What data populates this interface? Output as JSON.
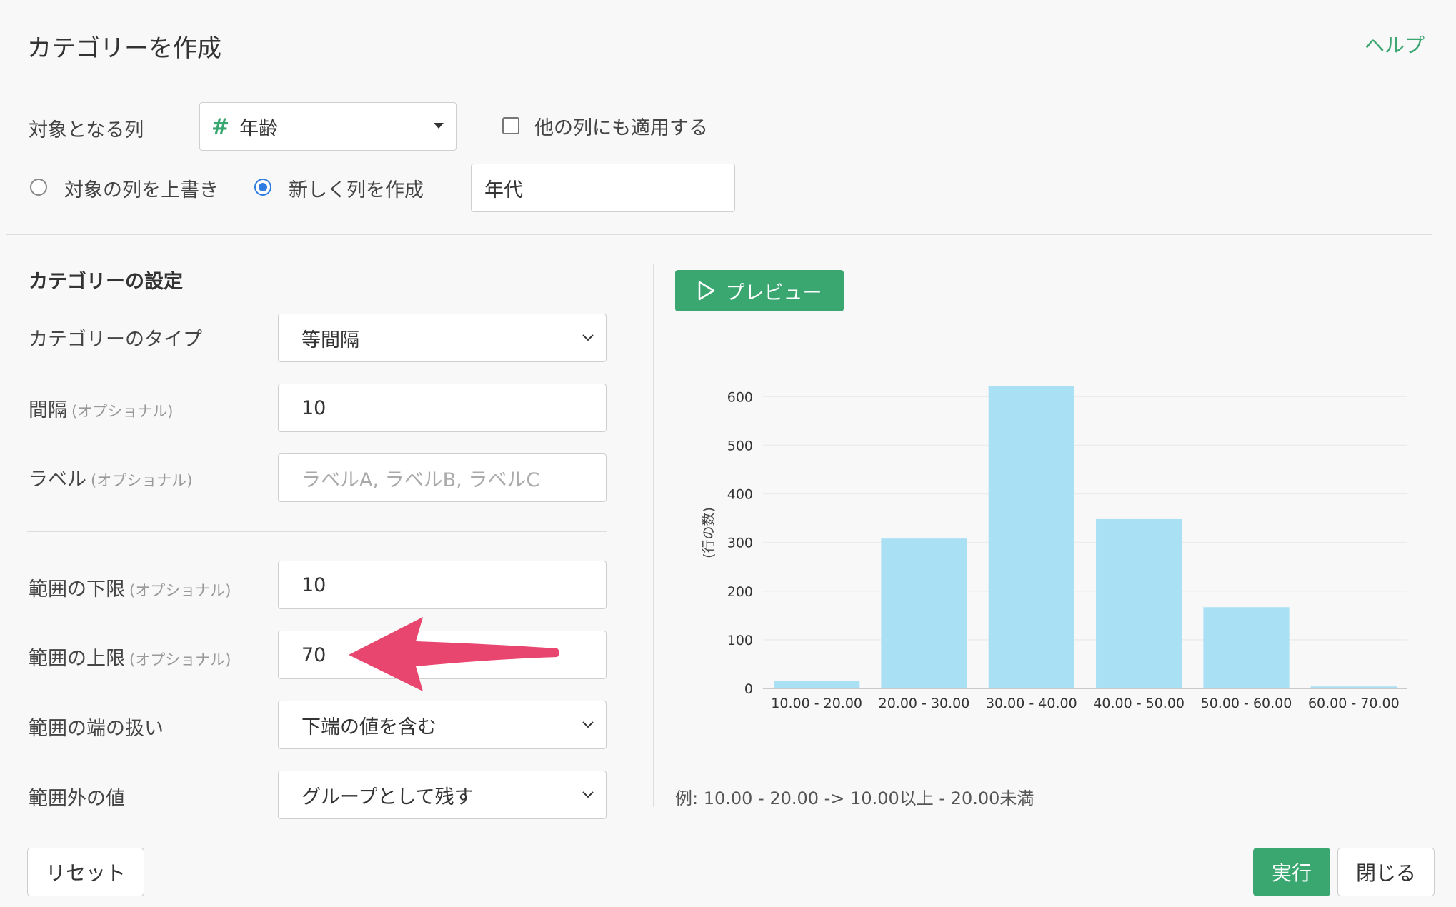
{
  "dialog": {
    "title": "カテゴリーを作成",
    "help": "ヘルプ"
  },
  "target": {
    "label": "対象となる列",
    "column_icon": "#",
    "column_value": "年齢",
    "apply_others_label": "他の列にも適用する"
  },
  "output": {
    "overwrite_label": "対象の列を上書き",
    "new_column_label": "新しく列を作成",
    "new_column_value": "年代"
  },
  "settings": {
    "section_title": "カテゴリーの設定",
    "optional": "(オプショナル)",
    "type_label": "カテゴリーのタイプ",
    "type_value": "等間隔",
    "interval_label": "間隔",
    "interval_value": "10",
    "labels_label": "ラベル",
    "labels_placeholder": "ラベルA, ラベルB, ラベルC",
    "lower_label": "範囲の下限",
    "lower_value": "10",
    "upper_label": "範囲の上限",
    "upper_value": "70",
    "edge_label": "範囲の端の扱い",
    "edge_value": "下端の値を含む",
    "outside_label": "範囲外の値",
    "outside_value": "グループとして残す"
  },
  "preview": {
    "button_label": "プレビュー",
    "example": "例: 10.00 - 20.00 -> 10.00以上 - 20.00未満"
  },
  "footer": {
    "reset": "リセット",
    "run": "実行",
    "close": "閉じる"
  },
  "colors": {
    "accent": "#3aa771",
    "bar": "#a9e0f3",
    "arrow": "#e8456f",
    "radio": "#2f7de1"
  },
  "chart_data": {
    "type": "bar",
    "categories": [
      "10.00 - 20.00",
      "20.00 - 30.00",
      "30.00 - 40.00",
      "40.00 - 50.00",
      "50.00 - 60.00",
      "60.00 - 70.00"
    ],
    "values": [
      15,
      308,
      622,
      348,
      167,
      4
    ],
    "ylabel": "(行の数)",
    "yticks": [
      0,
      100,
      200,
      300,
      400,
      500,
      600
    ],
    "ylim": [
      0,
      640
    ],
    "grid": true
  }
}
